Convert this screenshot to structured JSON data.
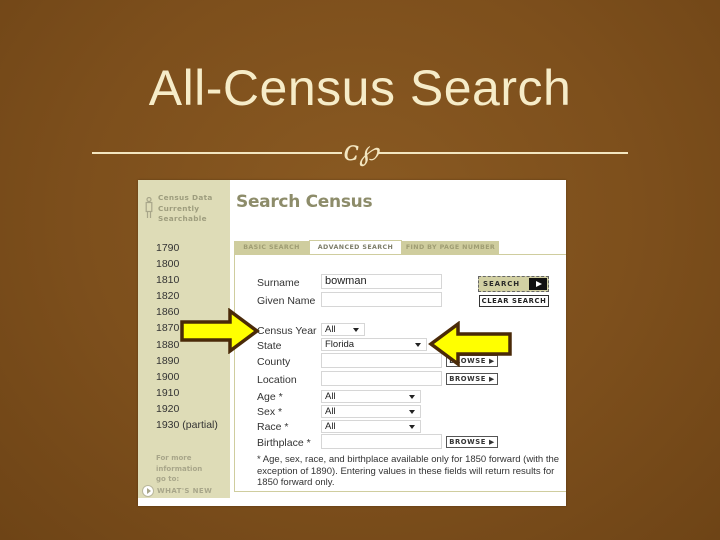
{
  "slide": {
    "title": "All-Census Search",
    "divider_glyph": "ᴄ℘",
    "colors": {
      "background": "#7d4f1c",
      "title_text": "#f6ecc8",
      "highlight_arrow": "#ffff00",
      "arrow_outline": "#4a2a08"
    }
  },
  "sidebar": {
    "heading": [
      "Census Data",
      "Currently",
      "Searchable"
    ],
    "years": [
      "1790",
      "1800",
      "1810",
      "1820",
      "1860",
      "1870",
      "1880",
      "1890",
      "1900",
      "1910",
      "1920",
      "1930 (partial)"
    ],
    "more_info": [
      "For more",
      "information",
      "go to:"
    ],
    "whats_new_label": "WHAT'S NEW"
  },
  "main": {
    "page_title": "Search Census",
    "tabs": [
      {
        "label": "BASIC SEARCH",
        "active": false
      },
      {
        "label": "ADVANCED SEARCH",
        "active": true
      },
      {
        "label": "FIND BY PAGE NUMBER",
        "active": false
      }
    ],
    "form": {
      "surname": {
        "label": "Surname",
        "value": "bowman"
      },
      "given_name": {
        "label": "Given Name",
        "value": ""
      },
      "census_year": {
        "label": "Census Year",
        "selected": "All"
      },
      "state": {
        "label": "State",
        "selected": "Florida"
      },
      "county": {
        "label": "County",
        "value": ""
      },
      "location": {
        "label": "Location",
        "value": ""
      },
      "age": {
        "label": "Age *",
        "selected": "All"
      },
      "sex": {
        "label": "Sex *",
        "selected": "All"
      },
      "race": {
        "label": "Race *",
        "selected": "All"
      },
      "birthplace": {
        "label": "Birthplace *",
        "value": ""
      }
    },
    "buttons": {
      "search": "SEARCH",
      "clear_search": "CLEAR SEARCH",
      "browse": "BROWSE ▶"
    },
    "footnote": "* Age, sex, race, and birthplace available only for 1850 forward (with the exception of 1890). Entering values in these fields will return results for 1850 forward only."
  }
}
